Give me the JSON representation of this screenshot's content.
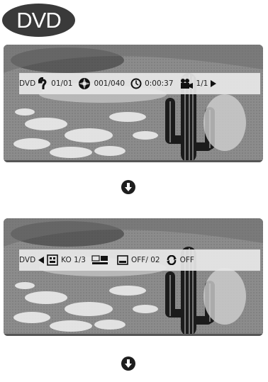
{
  "badge": {
    "label": "DVD"
  },
  "screen1": {
    "osd": {
      "mode": "DVD",
      "title": "01/01",
      "chapter": "001/040",
      "time": "0:00:37",
      "angle": "1/1"
    }
  },
  "screen2": {
    "osd": {
      "mode": "DVD",
      "audio": "KO 1/3",
      "subtitle": "OFF/ 02",
      "repeat": "OFF"
    }
  },
  "icons": [
    "title-icon",
    "chapter-icon",
    "clock-icon",
    "camera-angle-icon",
    "audio-icon",
    "sound-effect-icon",
    "subtitle-icon",
    "repeat-icon",
    "arrow-down-icon"
  ],
  "colors": {
    "badge": "#3a3a3a",
    "osd_bar": "#e8e8e8",
    "arrow": "#1e1e1e"
  }
}
